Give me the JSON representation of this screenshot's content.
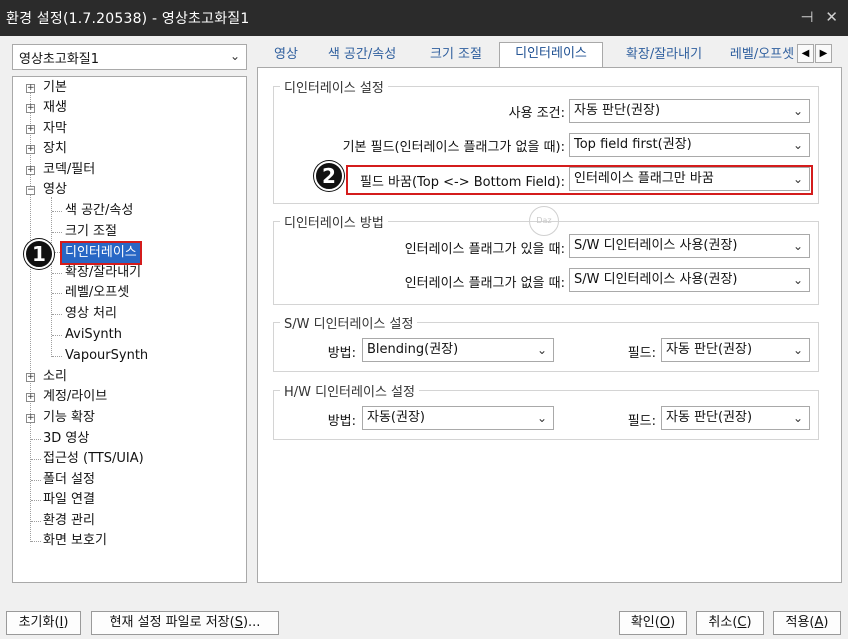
{
  "window": {
    "title": "환경 설정(1.7.20538) - 영상초고화질1",
    "pin_icon": "pin-icon",
    "close_icon": "close-icon"
  },
  "preset": {
    "value": "영상초고화질1"
  },
  "tree": {
    "items": [
      {
        "label": "기본",
        "expander": "+"
      },
      {
        "label": "재생",
        "expander": "+"
      },
      {
        "label": "자막",
        "expander": "+"
      },
      {
        "label": "장치",
        "expander": "+"
      },
      {
        "label": "코덱/필터",
        "expander": "+"
      },
      {
        "label": "영상",
        "expander": "−"
      },
      {
        "label": "색 공간/속성"
      },
      {
        "label": "크기 조절"
      },
      {
        "label": "디인터레이스"
      },
      {
        "label": "확장/잘라내기"
      },
      {
        "label": "레벨/오프셋"
      },
      {
        "label": "영상 처리"
      },
      {
        "label": "AviSynth"
      },
      {
        "label": "VapourSynth"
      },
      {
        "label": "소리",
        "expander": "+"
      },
      {
        "label": "계정/라이브",
        "expander": "+"
      },
      {
        "label": "기능 확장",
        "expander": "+"
      },
      {
        "label": "3D 영상"
      },
      {
        "label": "접근성 (TTS/UIA)"
      },
      {
        "label": "폴더 설정"
      },
      {
        "label": "파일 연결"
      },
      {
        "label": "환경 관리"
      },
      {
        "label": "화면 보호기"
      }
    ]
  },
  "tabs": [
    "영상",
    "색 공간/속성",
    "크기 조절",
    "디인터레이스",
    "확장/잘라내기",
    "레벨/오프셋"
  ],
  "tab_scroll": {
    "left": "◀",
    "right": "▶"
  },
  "annotations": {
    "one": "1",
    "two": "2"
  },
  "groups": {
    "deint_settings": {
      "title": "디인터레이스 설정",
      "use_condition": {
        "label": "사용 조건:",
        "value": "자동 판단(권장)"
      },
      "default_field": {
        "label": "기본 필드(인터레이스 플래그가 없을 때):",
        "value": "Top field first(권장)"
      },
      "field_swap": {
        "label": "필드 바꿈(Top <-> Bottom Field):",
        "value": "인터레이스 플래그만 바꿈"
      }
    },
    "deint_method": {
      "title": "디인터레이스 방법",
      "with_flag": {
        "label": "인터레이스 플래그가 있을 때:",
        "value": "S/W 디인터레이스 사용(권장)"
      },
      "without_flag": {
        "label": "인터레이스 플래그가 없을 때:",
        "value": "S/W 디인터레이스 사용(권장)"
      }
    },
    "sw_settings": {
      "title": "S/W 디인터레이스 설정",
      "method": {
        "label": "방법:",
        "value": "Blending(권장)"
      },
      "field": {
        "label": "필드:",
        "value": "자동 판단(권장)"
      }
    },
    "hw_settings": {
      "title": "H/W 디인터레이스 설정",
      "method": {
        "label": "방법:",
        "value": "자동(권장)"
      },
      "field": {
        "label": "필드:",
        "value": "자동 판단(권장)"
      }
    }
  },
  "watermark": {
    "text": "Daz"
  },
  "buttons": {
    "reset": {
      "label": "초기화(",
      "key": "I",
      "end": ")"
    },
    "save": {
      "label": "현재 설정 파일로 저장(",
      "key": "S",
      "end": ")..."
    },
    "ok": {
      "label": "확인(",
      "key": "O",
      "end": ")"
    },
    "cancel": {
      "label": "취소(",
      "key": "C",
      "end": ")"
    },
    "apply": {
      "label": "적용(",
      "key": "A",
      "end": ")"
    }
  }
}
